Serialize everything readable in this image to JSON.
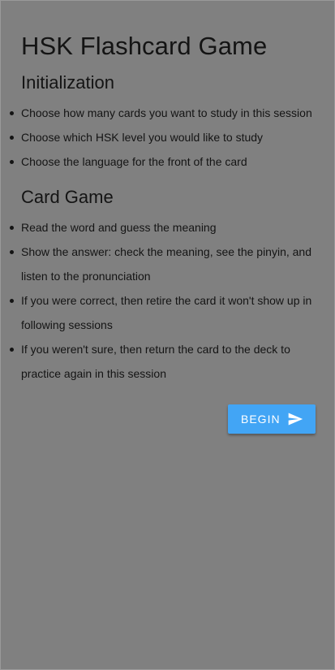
{
  "title": "HSK Flashcard Game",
  "sections": [
    {
      "heading": "Initialization",
      "items": [
        "Choose how many cards you want to study in this session",
        "Choose which HSK level you would like to study",
        "Choose the language for the front of the card"
      ]
    },
    {
      "heading": "Card Game",
      "items": [
        "Read the word and guess the meaning",
        "Show the answer: check the meaning, see the pinyin, and listen to the pronunciation",
        "If you were correct, then retire the card it won't show up in following sessions",
        "If you weren't sure, then return the card to the deck to practice again in this session"
      ]
    }
  ],
  "begin_button": {
    "label": "BEGIN",
    "icon": "send-icon"
  },
  "colors": {
    "background": "#808080",
    "text": "#141414",
    "button": "#42a5f5",
    "button_text": "#ffffff"
  }
}
